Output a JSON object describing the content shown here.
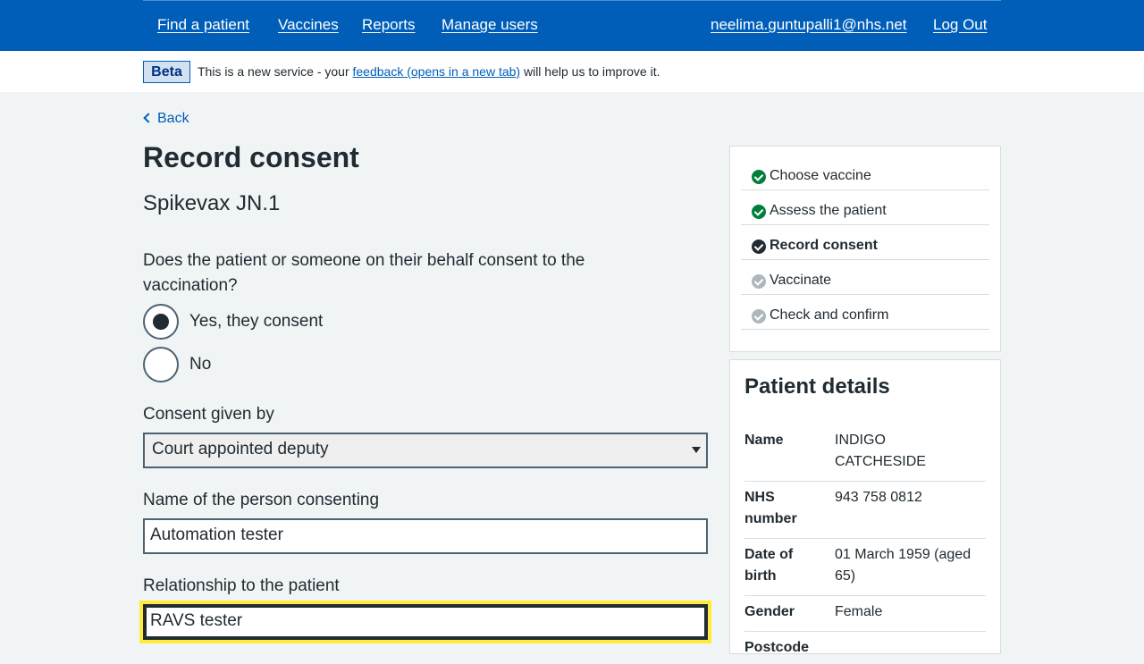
{
  "nav": {
    "find_patient": "Find a patient",
    "vaccines": "Vaccines",
    "reports": "Reports",
    "manage_users": "Manage users",
    "user_email": "neelima.guntupalli1@nhs.net",
    "logout": "Log Out"
  },
  "beta": {
    "tag": "Beta",
    "text_before": "This is a new service - your ",
    "link": "feedback (opens in a new tab)",
    "text_after": " will help us to improve it."
  },
  "back_label": "Back",
  "page_title": "Record consent",
  "vaccine_name": "Spikevax JN.1",
  "consent_question": "Does the patient or someone on their behalf consent to the vaccination?",
  "consent_options": [
    {
      "label": "Yes, they consent",
      "selected": true
    },
    {
      "label": "No",
      "selected": false
    }
  ],
  "consent_given_by": {
    "label": "Consent given by",
    "value": "Court appointed deputy"
  },
  "consenter_name": {
    "label": "Name of the person consenting",
    "value": "Automation tester"
  },
  "relationship": {
    "label": "Relationship to the patient",
    "value": "RAVS tester"
  },
  "steps": [
    {
      "label": "Choose vaccine",
      "status": "done"
    },
    {
      "label": "Assess the patient",
      "status": "done"
    },
    {
      "label": "Record consent",
      "status": "current"
    },
    {
      "label": "Vaccinate",
      "status": "todo"
    },
    {
      "label": "Check and confirm",
      "status": "todo"
    }
  ],
  "patient_details": {
    "title": "Patient details",
    "rows": [
      {
        "key": "Name",
        "value": "INDIGO CATCHESIDE"
      },
      {
        "key": "NHS number",
        "value": "943 758 0812"
      },
      {
        "key": "Date of birth",
        "value": "01 March 1959 (aged 65)"
      },
      {
        "key": "Gender",
        "value": "Female"
      },
      {
        "key": "Postcode",
        "value": ""
      }
    ]
  },
  "colors": {
    "nhs_blue": "#005eb8",
    "focus_yellow": "#ffeb3b",
    "success_green": "#007f3b"
  }
}
